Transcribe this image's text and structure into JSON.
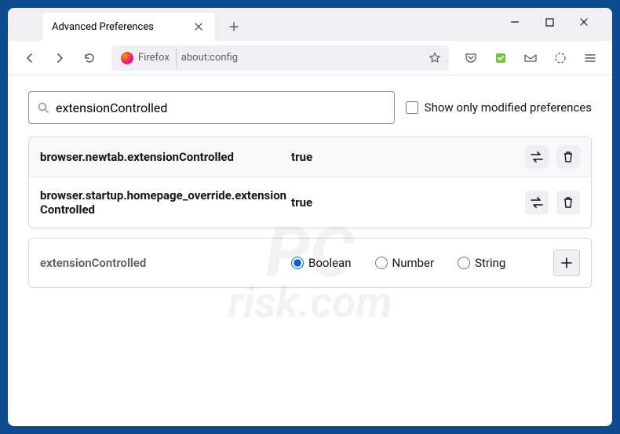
{
  "tab": {
    "title": "Advanced Preferences"
  },
  "toolbar": {
    "identity_label": "Firefox",
    "url": "about:config"
  },
  "search": {
    "value": "extensionControlled",
    "checkbox_label": "Show only modified preferences"
  },
  "prefs": [
    {
      "name": "browser.newtab.extensionControlled",
      "value": "true"
    },
    {
      "name": "browser.startup.homepage_override.extensionControlled",
      "value": "true"
    }
  ],
  "newpref": {
    "name": "extensionControlled",
    "types": {
      "boolean": "Boolean",
      "number": "Number",
      "string": "String"
    }
  },
  "watermark": {
    "line1": "PC",
    "line2": "risk.com"
  }
}
